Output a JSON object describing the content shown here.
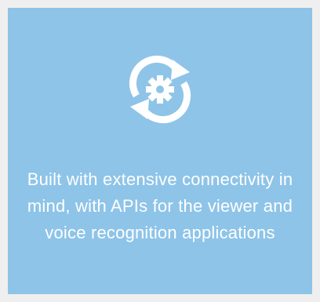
{
  "card": {
    "background": "#8ec4e8",
    "icon": "sync-gear-icon",
    "caption": "Built with extensive connectivity in mind, with APIs for the viewer and voice recognition applications"
  }
}
